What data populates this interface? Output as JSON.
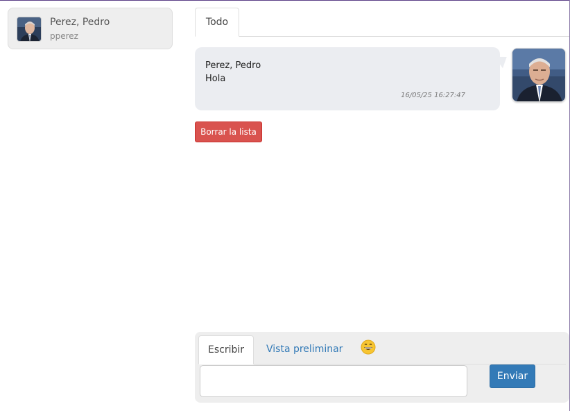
{
  "user": {
    "name": "Perez, Pedro",
    "login": "pperez"
  },
  "tabs": {
    "all_label": "Todo"
  },
  "messages": [
    {
      "author": "Perez, Pedro",
      "text": "Hola",
      "timestamp": "16/05/25 16:27:47"
    }
  ],
  "actions": {
    "clear_label": "Borrar la lista"
  },
  "composer": {
    "write_tab": "Escribir",
    "preview_tab": "Vista preliminar",
    "emoji_icon": "grinning-face-icon",
    "input_value": "",
    "send_label": "Enviar"
  },
  "colors": {
    "danger": "#d9534f",
    "primary": "#337ab7",
    "bubble": "#ebedf1"
  }
}
